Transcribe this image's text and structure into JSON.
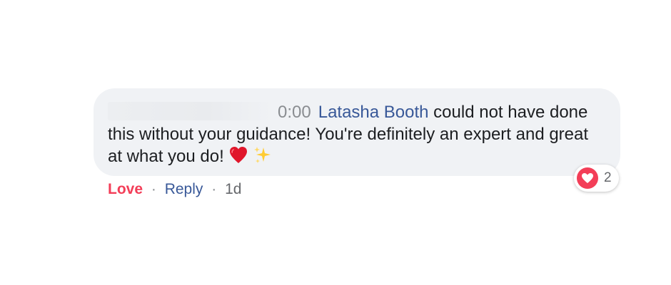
{
  "comment": {
    "timestamp": "0:00",
    "author": "Latasha Booth",
    "text": " could not have done this without your guidance! You're definitely an expert and great at what you do! ",
    "emojis": [
      "red-heart",
      "sparkles"
    ]
  },
  "reactions": {
    "icon": "heart-icon",
    "count": "2",
    "color": "#f33e58"
  },
  "actions": {
    "love_label": "Love",
    "separator": "·",
    "reply_label": "Reply",
    "time_ago": "1d"
  },
  "colors": {
    "bubble": "#f0f2f5",
    "link": "#385898",
    "love": "#f33e58",
    "muted": "#8a8d91"
  }
}
